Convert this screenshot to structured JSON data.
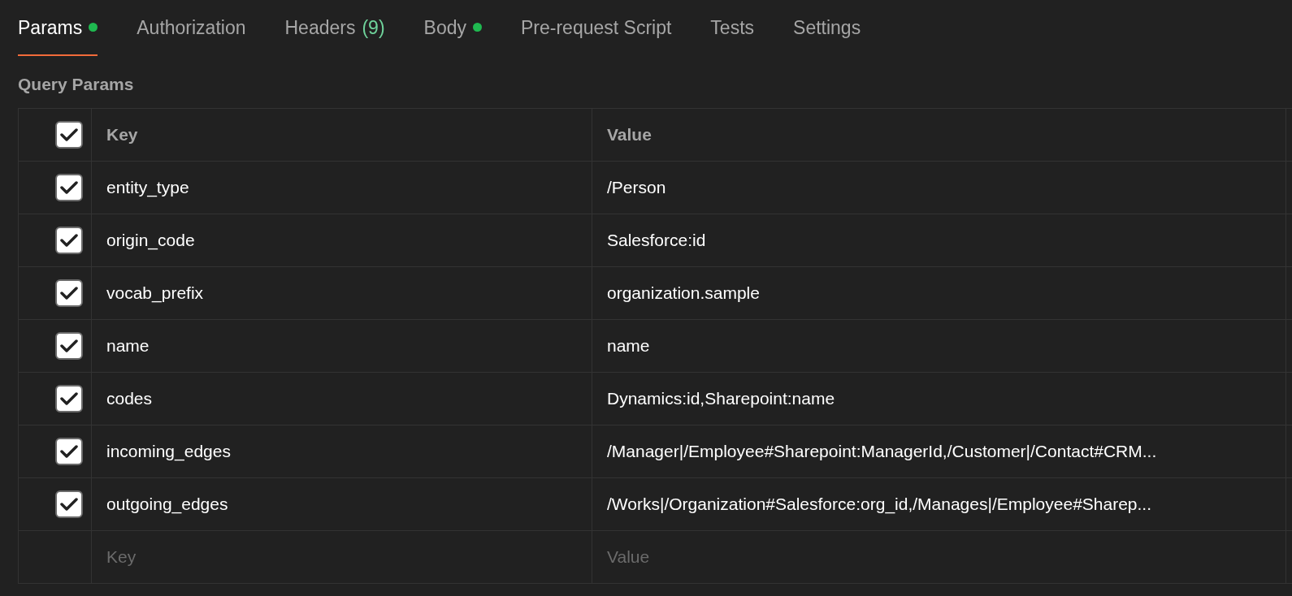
{
  "tabs": [
    {
      "label": "Params",
      "selected": true,
      "dot": true
    },
    {
      "label": "Authorization",
      "selected": false,
      "dot": false
    },
    {
      "label": "Headers",
      "selected": false,
      "dot": false,
      "count": "(9)"
    },
    {
      "label": "Body",
      "selected": false,
      "dot": true
    },
    {
      "label": "Pre-request Script",
      "selected": false,
      "dot": false
    },
    {
      "label": "Tests",
      "selected": false,
      "dot": false
    },
    {
      "label": "Settings",
      "selected": false,
      "dot": false
    }
  ],
  "section_title": "Query Params",
  "table": {
    "header": {
      "checked": true,
      "key": "Key",
      "value": "Value"
    },
    "rows": [
      {
        "checked": true,
        "key": "entity_type",
        "value": "/Person"
      },
      {
        "checked": true,
        "key": "origin_code",
        "value": "Salesforce:id"
      },
      {
        "checked": true,
        "key": "vocab_prefix",
        "value": "organization.sample"
      },
      {
        "checked": true,
        "key": "name",
        "value": "name"
      },
      {
        "checked": true,
        "key": "codes",
        "value": "Dynamics:id,Sharepoint:name"
      },
      {
        "checked": true,
        "key": "incoming_edges",
        "value": "/Manager|/Employee#Sharepoint:ManagerId,/Customer|/Contact#CRM..."
      },
      {
        "checked": true,
        "key": "outgoing_edges",
        "value": "/Works|/Organization#Salesforce:org_id,/Manages|/Employee#Sharep..."
      }
    ],
    "new_row": {
      "key_placeholder": "Key",
      "value_placeholder": "Value"
    }
  }
}
